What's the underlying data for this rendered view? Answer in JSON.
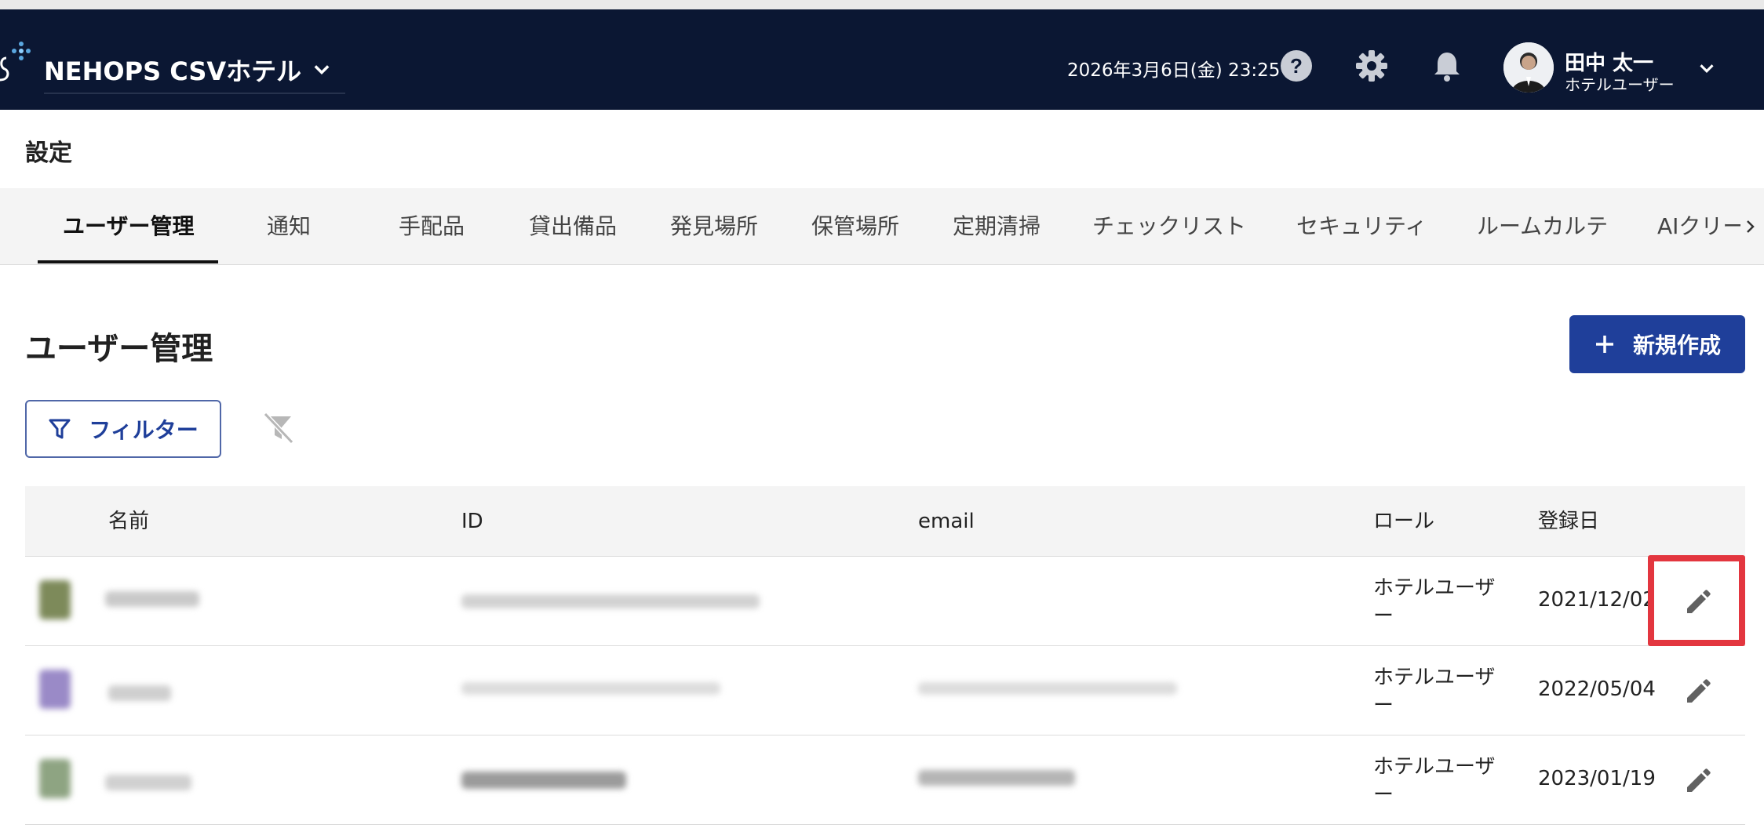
{
  "header": {
    "hotel_name": "NEHOPS CSVホテル",
    "datetime": "2026年3月6日(金) 23:25",
    "user_name": "田中 太一",
    "user_role": "ホテルユーザー",
    "icons": [
      "help-icon",
      "gear-icon",
      "bell-icon",
      "chevron-down-icon"
    ],
    "background": "#0b1733"
  },
  "page": {
    "title": "設定"
  },
  "tabs": [
    {
      "label": "ユーザー管理",
      "active": true
    },
    {
      "label": "通知"
    },
    {
      "label": "手配品"
    },
    {
      "label": "貸出備品"
    },
    {
      "label": "発見場所"
    },
    {
      "label": "保管場所"
    },
    {
      "label": "定期清掃"
    },
    {
      "label": "チェックリスト"
    },
    {
      "label": "セキュリティ"
    },
    {
      "label": "ルームカルテ"
    },
    {
      "label": "AIクリー"
    }
  ],
  "section": {
    "title": "ユーザー管理",
    "new_button": "新規作成",
    "filter_button": "フィルター"
  },
  "table": {
    "columns": [
      "名前",
      "ID",
      "email",
      "ロール",
      "登録日"
    ],
    "rows": [
      {
        "role": "ホテルユーザー",
        "date": "2021/12/02"
      },
      {
        "role": "ホテルユーザー",
        "date": "2022/05/04"
      },
      {
        "role": "ホテルユーザー",
        "date": "2023/01/19"
      }
    ]
  },
  "colors": {
    "accent": "#1f3f9a",
    "highlight": "#e3363f"
  }
}
